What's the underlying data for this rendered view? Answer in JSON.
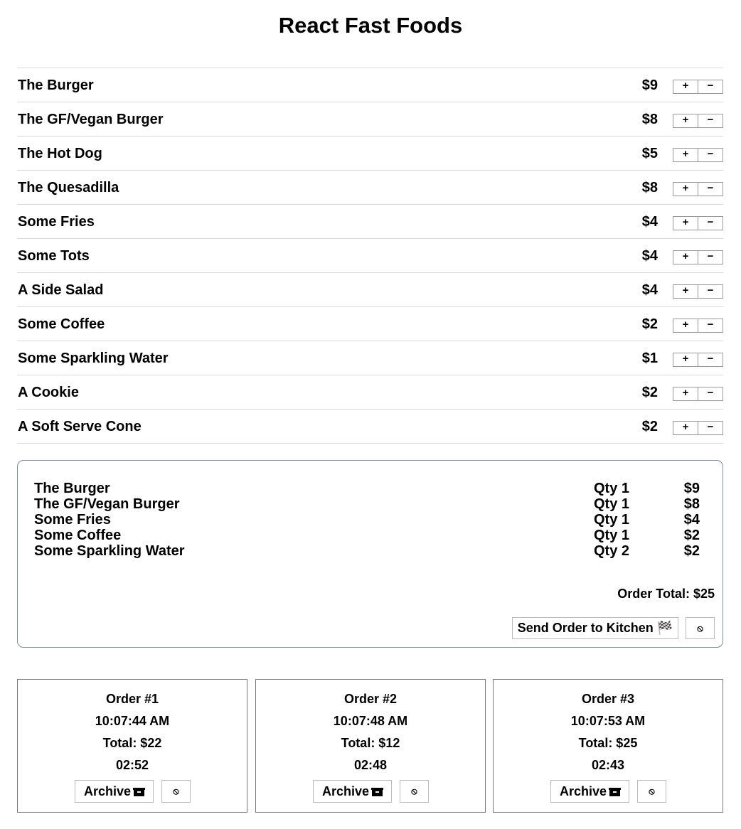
{
  "title": "React Fast Foods",
  "menu": [
    {
      "name": "The Burger",
      "price": "$9"
    },
    {
      "name": "The GF/Vegan Burger",
      "price": "$8"
    },
    {
      "name": "The Hot Dog",
      "price": "$5"
    },
    {
      "name": "The Quesadilla",
      "price": "$8"
    },
    {
      "name": "Some Fries",
      "price": "$4"
    },
    {
      "name": "Some Tots",
      "price": "$4"
    },
    {
      "name": "A Side Salad",
      "price": "$4"
    },
    {
      "name": "Some Coffee",
      "price": "$2"
    },
    {
      "name": "Some Sparkling Water",
      "price": "$1"
    },
    {
      "name": "A Cookie",
      "price": "$2"
    },
    {
      "name": "A Soft Serve Cone",
      "price": "$2"
    }
  ],
  "stepper": {
    "plus": "+",
    "minus": "−"
  },
  "cart": {
    "lines": [
      {
        "name": "The Burger",
        "qty": "Qty 1",
        "price": "$9"
      },
      {
        "name": "The GF/Vegan Burger",
        "qty": "Qty 1",
        "price": "$8"
      },
      {
        "name": "Some Fries",
        "qty": "Qty 1",
        "price": "$4"
      },
      {
        "name": "Some Coffee",
        "qty": "Qty 1",
        "price": "$2"
      },
      {
        "name": "Some Sparkling Water",
        "qty": "Qty 2",
        "price": "$2"
      }
    ],
    "total": "Order Total: $25",
    "send_label": "Send Order to Kitchen 🏁",
    "cancel_icon": "⦸"
  },
  "tickets": [
    {
      "title": "Order #1",
      "time": "10:07:44 AM",
      "total": "Total: $22",
      "elapsed": "02:52"
    },
    {
      "title": "Order #2",
      "time": "10:07:48 AM",
      "total": "Total: $12",
      "elapsed": "02:48"
    },
    {
      "title": "Order #3",
      "time": "10:07:53 AM",
      "total": "Total: $25",
      "elapsed": "02:43"
    }
  ],
  "ticket_actions": {
    "archive_label": "Archive",
    "cancel_icon": "⦸"
  }
}
